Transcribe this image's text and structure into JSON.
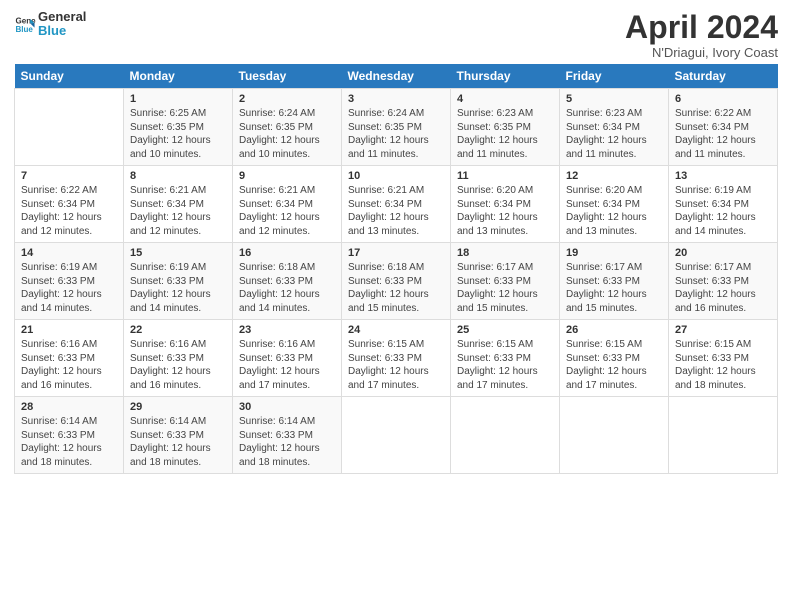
{
  "header": {
    "logo_line1": "General",
    "logo_line2": "Blue",
    "title": "April 2024",
    "subtitle": "N'Driagui, Ivory Coast"
  },
  "days_of_week": [
    "Sunday",
    "Monday",
    "Tuesday",
    "Wednesday",
    "Thursday",
    "Friday",
    "Saturday"
  ],
  "weeks": [
    [
      {
        "day": "",
        "info": ""
      },
      {
        "day": "1",
        "info": "Sunrise: 6:25 AM\nSunset: 6:35 PM\nDaylight: 12 hours\nand 10 minutes."
      },
      {
        "day": "2",
        "info": "Sunrise: 6:24 AM\nSunset: 6:35 PM\nDaylight: 12 hours\nand 10 minutes."
      },
      {
        "day": "3",
        "info": "Sunrise: 6:24 AM\nSunset: 6:35 PM\nDaylight: 12 hours\nand 11 minutes."
      },
      {
        "day": "4",
        "info": "Sunrise: 6:23 AM\nSunset: 6:35 PM\nDaylight: 12 hours\nand 11 minutes."
      },
      {
        "day": "5",
        "info": "Sunrise: 6:23 AM\nSunset: 6:34 PM\nDaylight: 12 hours\nand 11 minutes."
      },
      {
        "day": "6",
        "info": "Sunrise: 6:22 AM\nSunset: 6:34 PM\nDaylight: 12 hours\nand 11 minutes."
      }
    ],
    [
      {
        "day": "7",
        "info": "Sunrise: 6:22 AM\nSunset: 6:34 PM\nDaylight: 12 hours\nand 12 minutes."
      },
      {
        "day": "8",
        "info": "Sunrise: 6:21 AM\nSunset: 6:34 PM\nDaylight: 12 hours\nand 12 minutes."
      },
      {
        "day": "9",
        "info": "Sunrise: 6:21 AM\nSunset: 6:34 PM\nDaylight: 12 hours\nand 12 minutes."
      },
      {
        "day": "10",
        "info": "Sunrise: 6:21 AM\nSunset: 6:34 PM\nDaylight: 12 hours\nand 13 minutes."
      },
      {
        "day": "11",
        "info": "Sunrise: 6:20 AM\nSunset: 6:34 PM\nDaylight: 12 hours\nand 13 minutes."
      },
      {
        "day": "12",
        "info": "Sunrise: 6:20 AM\nSunset: 6:34 PM\nDaylight: 12 hours\nand 13 minutes."
      },
      {
        "day": "13",
        "info": "Sunrise: 6:19 AM\nSunset: 6:34 PM\nDaylight: 12 hours\nand 14 minutes."
      }
    ],
    [
      {
        "day": "14",
        "info": "Sunrise: 6:19 AM\nSunset: 6:33 PM\nDaylight: 12 hours\nand 14 minutes."
      },
      {
        "day": "15",
        "info": "Sunrise: 6:19 AM\nSunset: 6:33 PM\nDaylight: 12 hours\nand 14 minutes."
      },
      {
        "day": "16",
        "info": "Sunrise: 6:18 AM\nSunset: 6:33 PM\nDaylight: 12 hours\nand 14 minutes."
      },
      {
        "day": "17",
        "info": "Sunrise: 6:18 AM\nSunset: 6:33 PM\nDaylight: 12 hours\nand 15 minutes."
      },
      {
        "day": "18",
        "info": "Sunrise: 6:17 AM\nSunset: 6:33 PM\nDaylight: 12 hours\nand 15 minutes."
      },
      {
        "day": "19",
        "info": "Sunrise: 6:17 AM\nSunset: 6:33 PM\nDaylight: 12 hours\nand 15 minutes."
      },
      {
        "day": "20",
        "info": "Sunrise: 6:17 AM\nSunset: 6:33 PM\nDaylight: 12 hours\nand 16 minutes."
      }
    ],
    [
      {
        "day": "21",
        "info": "Sunrise: 6:16 AM\nSunset: 6:33 PM\nDaylight: 12 hours\nand 16 minutes."
      },
      {
        "day": "22",
        "info": "Sunrise: 6:16 AM\nSunset: 6:33 PM\nDaylight: 12 hours\nand 16 minutes."
      },
      {
        "day": "23",
        "info": "Sunrise: 6:16 AM\nSunset: 6:33 PM\nDaylight: 12 hours\nand 17 minutes."
      },
      {
        "day": "24",
        "info": "Sunrise: 6:15 AM\nSunset: 6:33 PM\nDaylight: 12 hours\nand 17 minutes."
      },
      {
        "day": "25",
        "info": "Sunrise: 6:15 AM\nSunset: 6:33 PM\nDaylight: 12 hours\nand 17 minutes."
      },
      {
        "day": "26",
        "info": "Sunrise: 6:15 AM\nSunset: 6:33 PM\nDaylight: 12 hours\nand 17 minutes."
      },
      {
        "day": "27",
        "info": "Sunrise: 6:15 AM\nSunset: 6:33 PM\nDaylight: 12 hours\nand 18 minutes."
      }
    ],
    [
      {
        "day": "28",
        "info": "Sunrise: 6:14 AM\nSunset: 6:33 PM\nDaylight: 12 hours\nand 18 minutes."
      },
      {
        "day": "29",
        "info": "Sunrise: 6:14 AM\nSunset: 6:33 PM\nDaylight: 12 hours\nand 18 minutes."
      },
      {
        "day": "30",
        "info": "Sunrise: 6:14 AM\nSunset: 6:33 PM\nDaylight: 12 hours\nand 18 minutes."
      },
      {
        "day": "",
        "info": ""
      },
      {
        "day": "",
        "info": ""
      },
      {
        "day": "",
        "info": ""
      },
      {
        "day": "",
        "info": ""
      }
    ]
  ]
}
